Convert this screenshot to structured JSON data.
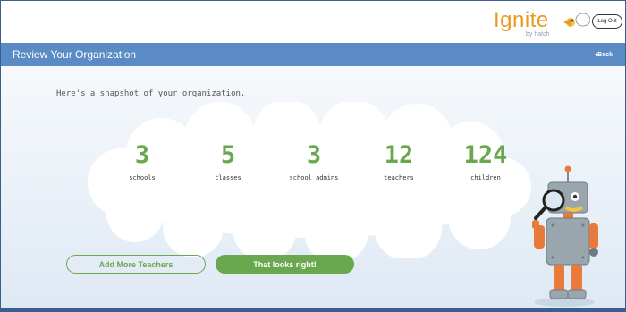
{
  "topbar": {
    "logo_text": "Ignite",
    "logo_sub": "by hatch",
    "logout_label": "Log Out"
  },
  "header": {
    "title": "Review Your Organization",
    "back_label": "Back",
    "back_icon": "chevron-left-icon"
  },
  "main": {
    "intro": "Here's a snapshot of your organization.",
    "stats": [
      {
        "value": "3",
        "label": "schools"
      },
      {
        "value": "5",
        "label": "classes"
      },
      {
        "value": "3",
        "label": "school admins"
      },
      {
        "value": "12",
        "label": "teachers"
      },
      {
        "value": "124",
        "label": "children"
      }
    ],
    "add_teachers_label": "Add More Teachers",
    "confirm_label": "That looks right!"
  },
  "colors": {
    "accent_green": "#6aa84f",
    "header_blue": "#5a8bc4",
    "logo_orange": "#e89a1f"
  }
}
